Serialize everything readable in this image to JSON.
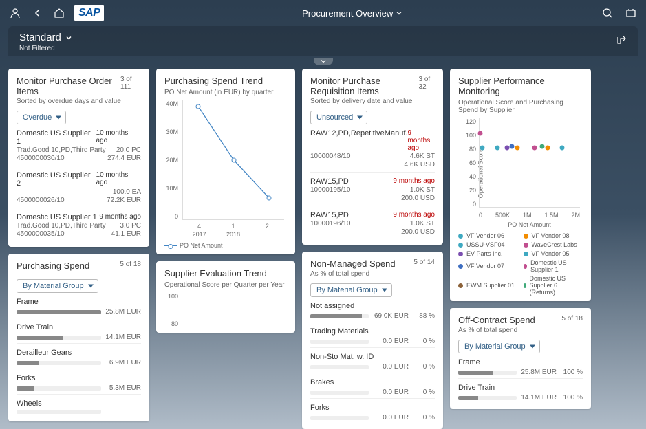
{
  "header": {
    "title": "Procurement Overview"
  },
  "variant": {
    "title": "Standard",
    "filter_status": "Not Filtered"
  },
  "cards": {
    "po_items": {
      "title": "Monitor Purchase Order Items",
      "count": "3 of 111",
      "sub": "Sorted by overdue days and value",
      "filter": "Overdue",
      "items": [
        {
          "name": "Domestic US Supplier 1",
          "ago": "10 months ago",
          "l2a": "Trad.Good 10,PD,Third Party",
          "l2b": "20.0 PC",
          "l3a": "4500000030/10",
          "l3b": "274.4 EUR"
        },
        {
          "name": "Domestic US Supplier 2",
          "ago": "10 months ago",
          "l2a": "",
          "l2b": "100.0 EA",
          "l3a": "4500000026/10",
          "l3b": "72.2K EUR"
        },
        {
          "name": "Domestic US Supplier 1",
          "ago": "9 months ago",
          "l2a": "Trad.Good 10,PD,Third Party",
          "l2b": "3.0 PC",
          "l3a": "4500000035/10",
          "l3b": "41.1 EUR"
        }
      ]
    },
    "purchasing_spend": {
      "title": "Purchasing Spend",
      "count": "5 of 18",
      "filter": "By Material Group",
      "items": [
        {
          "label": "Frame",
          "val": "25.8M EUR",
          "pct": 100
        },
        {
          "label": "Drive Train",
          "val": "14.1M EUR",
          "pct": 55
        },
        {
          "label": "Derailleur Gears",
          "val": "6.9M EUR",
          "pct": 27
        },
        {
          "label": "Forks",
          "val": "5.3M EUR",
          "pct": 20
        },
        {
          "label": "Wheels",
          "val": "",
          "pct": 0
        }
      ]
    },
    "spend_trend": {
      "title": "Purchasing Spend Trend",
      "sub": "PO Net Amount (in EUR) by quarter",
      "legend": "PO Net Amount"
    },
    "eval_trend": {
      "title": "Supplier Evaluation Trend",
      "sub": "Operational Score per Quarter per Year"
    },
    "pr_items": {
      "title": "Monitor Purchase Requisition Items",
      "count": "3 of 32",
      "sub": "Sorted by delivery date and value",
      "filter": "Unsourced",
      "items": [
        {
          "name": "RAW12,PD,RepetitiveManuf.",
          "ago": "9 months ago",
          "l2a": "10000048/10",
          "l2b": "4.6K ST",
          "l3a": "",
          "l3b": "4.6K USD"
        },
        {
          "name": "RAW15,PD",
          "ago": "9 months ago",
          "l2a": "10000195/10",
          "l2b": "1.0K ST",
          "l3a": "",
          "l3b": "200.0 USD"
        },
        {
          "name": "RAW15,PD",
          "ago": "9 months ago",
          "l2a": "10000196/10",
          "l2b": "1.0K ST",
          "l3a": "",
          "l3b": "200.0 USD"
        }
      ]
    },
    "non_managed": {
      "title": "Non-Managed Spend",
      "count": "5 of 14",
      "sub": "As % of total spend",
      "filter": "By Material Group",
      "items": [
        {
          "label": "Not assigned",
          "val": "69.0K EUR",
          "pct": "88 %",
          "bar": 88
        },
        {
          "label": "Trading Materials",
          "val": "0.0 EUR",
          "pct": "0 %",
          "bar": 0
        },
        {
          "label": "Non-Sto Mat. w. ID",
          "val": "0.0 EUR",
          "pct": "0 %",
          "bar": 0
        },
        {
          "label": "Brakes",
          "val": "0.0 EUR",
          "pct": "0 %",
          "bar": 0
        },
        {
          "label": "Forks",
          "val": "0.0 EUR",
          "pct": "0 %",
          "bar": 0
        }
      ]
    },
    "perf": {
      "title": "Supplier Performance Monitoring",
      "sub": "Operational Score and Purchasing Spend by Supplier",
      "ylabel": "Operational Score",
      "xlabel": "PO Net Amount",
      "legend": [
        {
          "name": "VF Vendor 06",
          "color": "#3fa9c1"
        },
        {
          "name": "VF Vendor 08",
          "color": "#f28c00"
        },
        {
          "name": "USSU-VSF04",
          "color": "#3fa9c1"
        },
        {
          "name": "WaveCrest Labs",
          "color": "#c14f8f"
        },
        {
          "name": "EV Parts Inc.",
          "color": "#7b4fb0"
        },
        {
          "name": "VF Vendor 05",
          "color": "#3fa9c1"
        },
        {
          "name": "VF Vendor 07",
          "color": "#3f6fc1"
        },
        {
          "name": "Domestic US Supplier 1",
          "color": "#c14f8f"
        },
        {
          "name": "EWM Supplier 01",
          "color": "#8c6239"
        },
        {
          "name": "Domestic US Supplier 6 (Returns)",
          "color": "#3fa97a"
        }
      ]
    },
    "off_contract": {
      "title": "Off-Contract Spend",
      "count": "5 of 18",
      "sub": "As % of total spend",
      "filter": "By Material Group",
      "items": [
        {
          "label": "Frame",
          "val": "25.8M EUR",
          "pct": "100 %",
          "bar": 60
        },
        {
          "label": "Drive Train",
          "val": "14.1M EUR",
          "pct": "100 %",
          "bar": 34
        }
      ]
    }
  },
  "chart_data": [
    {
      "type": "line",
      "title": "Purchasing Spend Trend",
      "xlabel": "quarter",
      "ylabel": "PO Net Amount (EUR)",
      "ylim": [
        0,
        40000000
      ],
      "y_ticks": [
        "40M",
        "30M",
        "20M",
        "10M",
        "0"
      ],
      "x": [
        "2017 Q4",
        "2018 Q1",
        "2018 Q2"
      ],
      "series": [
        {
          "name": "PO Net Amount",
          "values": [
            38000000,
            20000000,
            7000000
          ]
        }
      ]
    },
    {
      "type": "scatter",
      "title": "Supplier Performance Monitoring",
      "xlabel": "PO Net Amount",
      "ylabel": "Operational Score",
      "ylim": [
        0,
        120
      ],
      "xlim": [
        0,
        2000000
      ],
      "y_ticks": [
        "120",
        "100",
        "80",
        "60",
        "40",
        "20",
        "0"
      ],
      "x_ticks": [
        "0",
        "500K",
        "1M",
        "1.5M",
        "2M"
      ],
      "points": [
        {
          "x": 10000,
          "y": 100,
          "color": "#c14f8f"
        },
        {
          "x": 50000,
          "y": 80,
          "color": "#3fa9c1"
        },
        {
          "x": 350000,
          "y": 80,
          "color": "#3fa9c1"
        },
        {
          "x": 550000,
          "y": 80,
          "color": "#7b4fb0"
        },
        {
          "x": 650000,
          "y": 82,
          "color": "#3f6fc1"
        },
        {
          "x": 750000,
          "y": 80,
          "color": "#f28c00"
        },
        {
          "x": 1100000,
          "y": 80,
          "color": "#c14f8f"
        },
        {
          "x": 1250000,
          "y": 82,
          "color": "#3fa97a"
        },
        {
          "x": 1350000,
          "y": 80,
          "color": "#f28c00"
        },
        {
          "x": 1650000,
          "y": 80,
          "color": "#3fa9c1"
        }
      ]
    },
    {
      "type": "bar",
      "title": "Purchasing Spend",
      "categories": [
        "Frame",
        "Drive Train",
        "Derailleur Gears",
        "Forks",
        "Wheels"
      ],
      "values": [
        25800000,
        14100000,
        6900000,
        5300000,
        null
      ],
      "unit": "EUR"
    },
    {
      "type": "line",
      "title": "Supplier Evaluation Trend",
      "ylabel": "Operational Score",
      "y_ticks": [
        "100",
        "80"
      ],
      "ylim": [
        70,
        105
      ],
      "x": [],
      "series": []
    }
  ]
}
